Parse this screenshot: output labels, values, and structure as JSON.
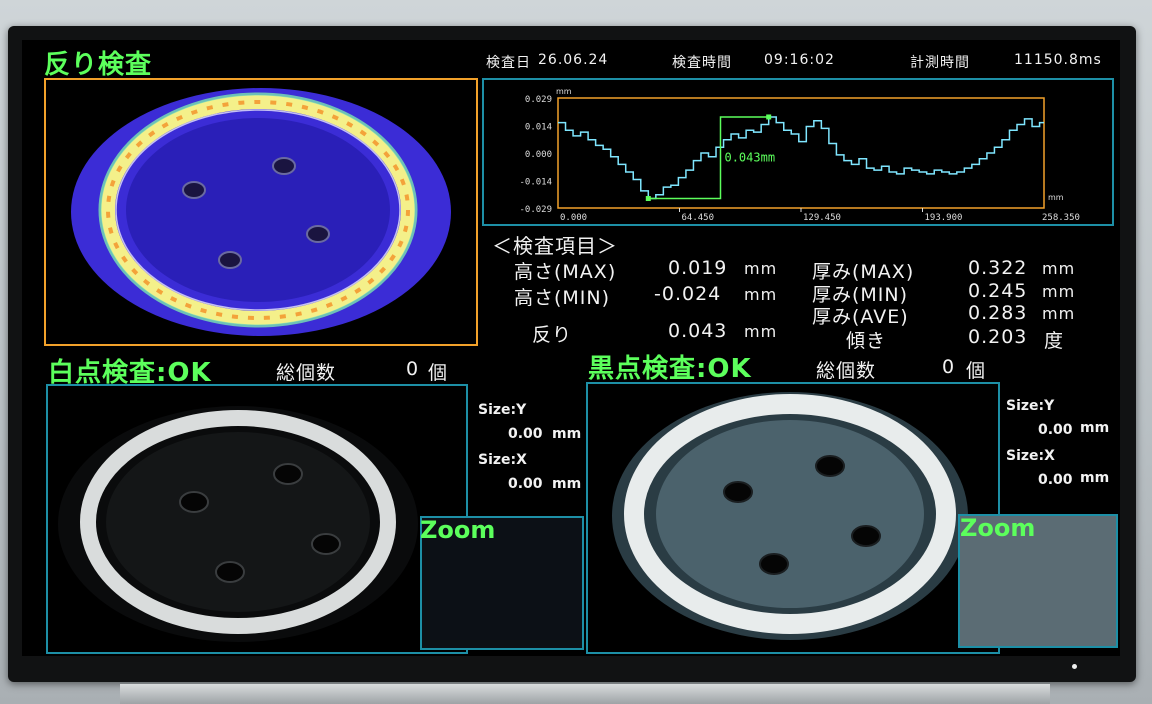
{
  "header": {
    "title": "反り検査",
    "inspection_date_label": "検査日",
    "inspection_date": "26.06.24",
    "inspection_time_label": "検査時間",
    "inspection_time": "09:16:02",
    "measure_time_label": "計測時間",
    "measure_time": "11150.8ms"
  },
  "graph": {
    "y_unit": "mm",
    "x_unit": "mm",
    "y_ticks": [
      "0.029",
      "0.014",
      "0.000",
      "-0.014",
      "-0.029"
    ],
    "x_ticks": [
      "0.000",
      "64.450",
      "129.450",
      "193.900",
      "258.350"
    ],
    "warp_annotation": "0.043mm",
    "colors": {
      "frame": "#f2a12a",
      "trace": "#7fe6ff",
      "marker": "#5cff5c"
    }
  },
  "chart_data": {
    "type": "line",
    "xlabel": "mm",
    "ylabel": "mm",
    "xlim": [
      0,
      258.35
    ],
    "ylim": [
      -0.029,
      0.029
    ],
    "series": [
      {
        "x": [
          0,
          4,
          8,
          12,
          16,
          20,
          24,
          28,
          32,
          36,
          40,
          44,
          48,
          52,
          56,
          60,
          64,
          68,
          72,
          76,
          80,
          84,
          88,
          92,
          96,
          100,
          104,
          108,
          112,
          116,
          120,
          124,
          128,
          132,
          136,
          140,
          144,
          148,
          152,
          156,
          160,
          164,
          168,
          172,
          176,
          180,
          184,
          188,
          192,
          196,
          200,
          204,
          208,
          212,
          216,
          220,
          224,
          228,
          232,
          236,
          240,
          244,
          248,
          252,
          256
        ],
        "values": [
          0.016,
          0.012,
          0.009,
          0.011,
          0.007,
          0.004,
          0.002,
          -0.002,
          -0.006,
          -0.01,
          -0.014,
          -0.02,
          -0.024,
          -0.022,
          -0.018,
          -0.017,
          -0.013,
          -0.009,
          -0.004,
          0.0,
          -0.002,
          0.003,
          0.007,
          0.01,
          0.008,
          0.012,
          0.011,
          0.015,
          0.019,
          0.016,
          0.012,
          0.01,
          0.006,
          0.014,
          0.017,
          0.013,
          0.005,
          -0.001,
          -0.004,
          -0.006,
          -0.003,
          -0.008,
          -0.009,
          -0.007,
          -0.01,
          -0.011,
          -0.008,
          -0.009,
          -0.01,
          -0.011,
          -0.009,
          -0.01,
          -0.011,
          -0.01,
          -0.008,
          -0.006,
          -0.003,
          0.0,
          0.003,
          0.007,
          0.012,
          0.015,
          0.018,
          0.014,
          0.016
        ]
      }
    ],
    "markers": {
      "min": {
        "x": 48,
        "y": -0.024
      },
      "max": {
        "x": 112,
        "y": 0.019
      }
    }
  },
  "items": {
    "heading": "＜検査項目＞",
    "height_max_label": "高さ(MAX)",
    "height_max_value": "0.019",
    "height_min_label": "高さ(MIN)",
    "height_min_value": "-0.024",
    "warp_label": "反り",
    "warp_value": "0.043",
    "thickness_max_label": "厚み(MAX)",
    "thickness_max_value": "0.322",
    "thickness_min_label": "厚み(MIN)",
    "thickness_min_value": "0.245",
    "thickness_ave_label": "厚み(AVE)",
    "thickness_ave_value": "0.283",
    "tilt_label": "傾き",
    "tilt_value": "0.203",
    "unit_mm": "mm",
    "unit_deg": "度"
  },
  "white": {
    "title": "白点検査:OK",
    "count_label": "総個数",
    "count_value": "0",
    "count_unit": "個",
    "size_y_label": "Size:Y",
    "size_y_value": "0.00",
    "size_x_label": "Size:X",
    "size_x_value": "0.00",
    "unit": "mm",
    "zoom_label": "Zoom"
  },
  "black": {
    "title": "黒点検査:OK",
    "count_label": "総個数",
    "count_value": "0",
    "count_unit": "個",
    "size_y_label": "Size:Y",
    "size_y_value": "0.00",
    "size_x_label": "Size:X",
    "size_x_value": "0.00",
    "unit": "mm",
    "zoom_label": "Zoom"
  }
}
